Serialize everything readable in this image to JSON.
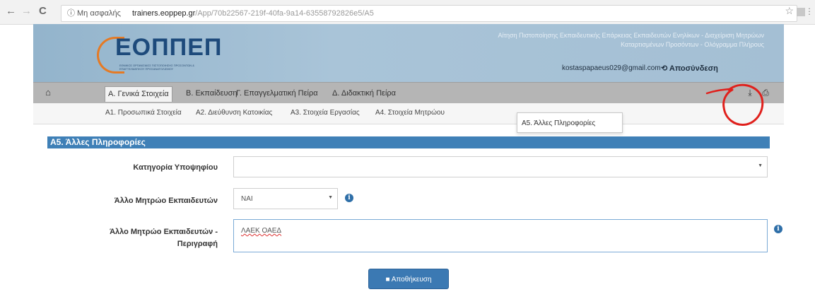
{
  "browser": {
    "back": "←",
    "forward": "→",
    "reload": "C",
    "info_icon": "ⓘ",
    "secure_label": "Μη ασφαλής",
    "url_host": "trainers.eoppep.gr",
    "url_path": "/App/70b22567-219f-40fa-9a14-63558792826e5/A5"
  },
  "header": {
    "logo_text": "ΕΟΠΠΕΠ",
    "logo_subtitle": "ΕΘΝΙΚΟΣ ΟΡΓΑΝΙΣΜΟΣ ΠΙΣΤΟΠΟΙΗΣΗΣ ΠΡΟΣΟΝΤΩΝ & ΕΠΑΓΓΕΛΜΑΤΙΚΟΥ ΠΡΟΣΑΝΑΤΟΛΙΣΜΟΥ",
    "title": "Αίτηση Πιστοποίησης Εκπαιδευτικής Επάρκειας Εκπαιδευτών Ενηλίκων - Διαχείριση Μητρώων Καταρτισμένων Προσόντων - Ολόγραμμα Πλήρους",
    "user_email": "kostaspapaeus029@gmail.com",
    "logout_label": "Αποσύνδεση",
    "logout_icon": "⟲"
  },
  "main_nav": {
    "home_icon": "⌂",
    "tabs": [
      "Α. Γενικά Στοιχεία",
      "Β. Εκπαίδευση",
      "Γ. Επαγγελματική Πείρα",
      "Δ. Διδακτική Πείρα"
    ],
    "download_icon": "⤓",
    "print_icon": "⎙"
  },
  "sub_nav": {
    "tabs": [
      "Α1. Προσωπικά Στοιχεία",
      "Α2. Διεύθυνση Κατοικίας",
      "Α3. Στοιχεία Εργασίας",
      "Α4. Στοιχεία Μητρώου"
    ],
    "dropdown_item": "Α5. Άλλες Πληροφορίες"
  },
  "section": {
    "title": "Α5. Άλλες Πληροφορίες"
  },
  "form": {
    "category_label": "Κατηγορία Υποψηφίου",
    "category_value": "",
    "registry_label": "Άλλο Μητρώο Εκπαιδευτών",
    "registry_value": "ΝΑΙ",
    "description_label_1": "Άλλο Μητρώο Εκπαιδευτών -",
    "description_label_2": "Περιγραφή",
    "description_value": "ΛΑΕΚ ΟΑΕΔ",
    "info_icon": "i",
    "save_label": "Αποθήκευση",
    "save_icon": "💾"
  },
  "colors": {
    "header_bg": "#a4bfd4",
    "nav_bg": "#b5b5b5",
    "section_bg": "#3f80b7",
    "button_bg": "#3b79b3",
    "annotation": "#e0201c"
  }
}
